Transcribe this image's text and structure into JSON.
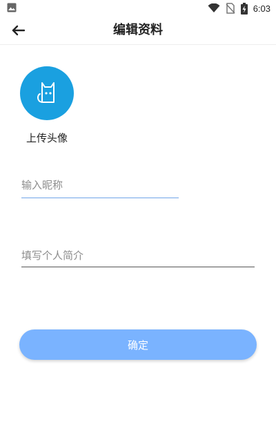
{
  "status_bar": {
    "time": "6:03",
    "icons": [
      "image-notification-icon",
      "wifi-icon",
      "no-sim-icon",
      "battery-charging-icon"
    ]
  },
  "header": {
    "title": "编辑资料",
    "back_icon": "arrow-left-icon"
  },
  "avatar": {
    "icon": "cat-icon",
    "background_color": "#1aa0e0",
    "upload_label": "上传头像"
  },
  "form": {
    "nickname": {
      "value": "",
      "placeholder": "输入昵称",
      "active_color": "#6ea4e8"
    },
    "bio": {
      "value": "",
      "placeholder": "填写个人简介"
    }
  },
  "actions": {
    "confirm_label": "确定",
    "confirm_color": "#7ab3ff"
  }
}
